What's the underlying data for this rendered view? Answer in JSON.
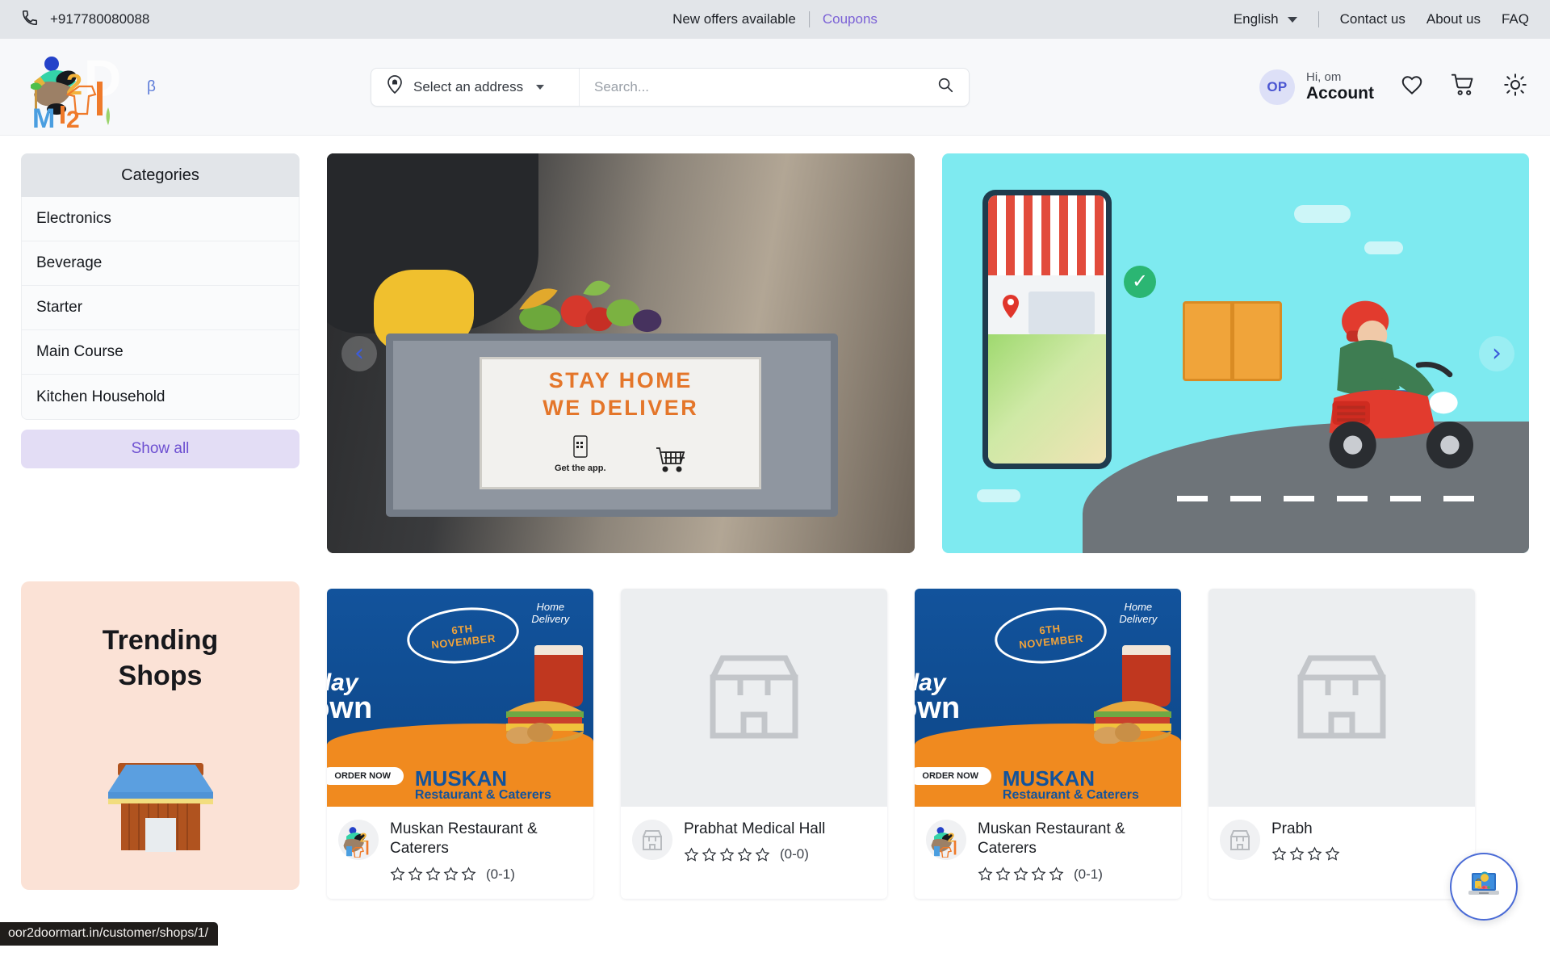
{
  "topbar": {
    "phone": "+917780080088",
    "phone_icon": "phone-icon",
    "offers_text": "New offers available",
    "coupons_label": "Coupons",
    "language": "English",
    "language_chevron": "chevron-down-icon",
    "links": [
      {
        "label": "Contact us"
      },
      {
        "label": "About us"
      },
      {
        "label": "FAQ"
      }
    ]
  },
  "header": {
    "logo_alt": "Door2DoorMart logo",
    "beta_label": "β",
    "address": {
      "icon": "location-pin-icon",
      "label": "Select an address",
      "chevron": "chevron-down-icon"
    },
    "search": {
      "placeholder": "Search...",
      "value": "",
      "icon": "search-icon"
    },
    "account": {
      "initials": "OP",
      "greeting": "Hi, om",
      "label": "Account"
    },
    "wishlist_icon": "heart-icon",
    "cart_icon": "shopping-cart-icon",
    "theme_icon": "sun-icon"
  },
  "sidebar": {
    "title": "Categories",
    "items": [
      {
        "label": "Electronics"
      },
      {
        "label": "Beverage"
      },
      {
        "label": "Starter"
      },
      {
        "label": "Main Course"
      },
      {
        "label": "Kitchen Household"
      }
    ],
    "show_all_label": "Show all"
  },
  "trending": {
    "line1": "Trending",
    "line2": "Shops",
    "illustration": "shop-3d-illustration"
  },
  "carousel": {
    "prev_icon": "chevron-left-icon",
    "next_icon": "chevron-right-icon",
    "slides": [
      {
        "name": "grocery-delivery-photo",
        "sign_line1": "STAY HOME",
        "sign_line2": "WE DELIVER",
        "sign_cta": "Get the app.",
        "cart_icon": "shopping-cart-icon"
      },
      {
        "name": "online-delivery-illustration",
        "check_icon": "check-circle-icon",
        "pin_icon": "location-pin-icon"
      }
    ]
  },
  "shops": [
    {
      "name": "Muskan Restaurant & Caterers",
      "rating": 0,
      "rating_count": "(0-1)",
      "logo": "muskan-logo",
      "image": "promo-banner",
      "promo": {
        "date": "6TH\nNOVEMBER",
        "date_line1": "6TH",
        "date_line2": "NOVEMBER",
        "home_delivery": "Home\nDelivery",
        "home_delivery_l1": "Home",
        "home_delivery_l2": "Delivery",
        "day_word": "day",
        "down_word": "own",
        "order_now": "ORDER NOW",
        "brand": "MUSKAN",
        "brand_sub": "Restaurant & Caterers"
      }
    },
    {
      "name": "Prabhat Medical Hall",
      "rating": 0,
      "rating_count": "(0-0)",
      "logo": "store-placeholder-icon",
      "image": "store-placeholder-icon"
    },
    {
      "name": "Muskan Restaurant & Caterers",
      "rating": 0,
      "rating_count": "(0-1)",
      "logo": "muskan-logo",
      "image": "promo-banner",
      "promo": {
        "date_line1": "6TH",
        "date_line2": "NOVEMBER",
        "home_delivery_l1": "Home",
        "home_delivery_l2": "Delivery",
        "day_word": "day",
        "down_word": "own",
        "order_now": "ORDER NOW",
        "brand": "MUSKAN",
        "brand_sub": "Restaurant & Caterers"
      }
    },
    {
      "name": "Prabh",
      "rating": 0,
      "rating_count": "",
      "logo": "store-placeholder-icon",
      "image": "store-placeholder-icon"
    }
  ],
  "chat_fab": {
    "icon": "support-agent-icon",
    "label": ""
  },
  "status_url": "oor2doormart.in/customer/shops/1/",
  "colors": {
    "accent_purple": "#6d4fd1",
    "topbar_bg": "#e2e5e9",
    "avatar_bg": "#dde0f7",
    "avatar_text": "#4b56d2",
    "trending_bg": "#fbe2d6",
    "carousel_arrow": "#3b5bdb",
    "fab_border": "#4a6bd6"
  }
}
